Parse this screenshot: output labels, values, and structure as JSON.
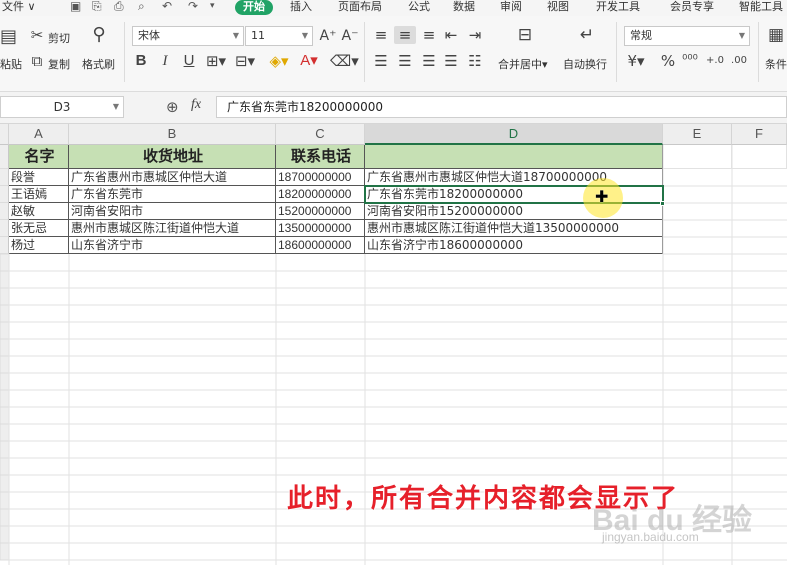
{
  "menubar": {
    "file": "文件",
    "tabs": [
      "开始",
      "插入",
      "页面布局",
      "公式",
      "数据",
      "审阅",
      "视图",
      "开发工具",
      "会员专享",
      "智能工具"
    ]
  },
  "ribbon": {
    "cut": "剪切",
    "paste": "粘贴",
    "copy": "复制",
    "format_painter": "格式刷",
    "font_name": "宋体",
    "font_size": "11",
    "merge_center": "合并居中",
    "wrap_text": "自动换行",
    "number_format": "常规",
    "conditional": "条件"
  },
  "formula_bar": {
    "name_box": "D3",
    "fx": "fx",
    "formula": "广东省东莞市18200000000"
  },
  "columns": [
    "A",
    "B",
    "C",
    "D",
    "E",
    "F"
  ],
  "table": {
    "headers": [
      "名字",
      "收货地址",
      "联系电话",
      ""
    ],
    "rows": [
      [
        "段誉",
        "广东省惠州市惠城区仲恺大道",
        "18700000000",
        "广东省惠州市惠城区仲恺大道18700000000"
      ],
      [
        "王语嫣",
        "广东省东莞市",
        "18200000000",
        "广东省东莞市18200000000"
      ],
      [
        "赵敏",
        "河南省安阳市",
        "15200000000",
        "河南省安阳市15200000000"
      ],
      [
        "张无忌",
        "惠州市惠城区陈江街道仲恺大道",
        "13500000000",
        "惠州市惠城区陈江街道仲恺大道13500000000"
      ],
      [
        "杨过",
        "山东省济宁市",
        "18600000000",
        "山东省济宁市18600000000"
      ]
    ]
  },
  "caption": "此时，所有合并内容都会显示了",
  "watermark": {
    "brand": "Bai du 经验",
    "url": "jingyan.baidu.com"
  },
  "colors": {
    "accent": "#21a366",
    "header_fill": "#c6e0b4",
    "selection": "#217346",
    "caption": "#e6202a"
  }
}
